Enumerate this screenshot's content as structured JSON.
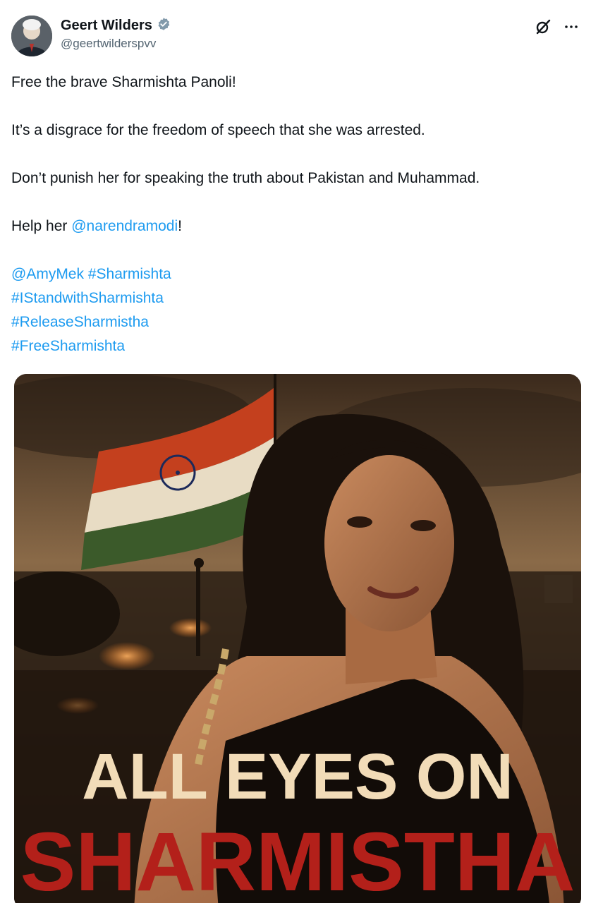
{
  "author": {
    "display_name": "Geert Wilders",
    "handle": "@geertwilderspvv",
    "verified": true
  },
  "tweet": {
    "line1": "Free the brave Sharmishta Panoli!",
    "line2": "It’s a disgrace for the freedom of speech that she was arrested.",
    "line3": "Don’t punish her for speaking the truth about Pakistan and Muhammad.",
    "help_prefix": "Help her ",
    "mention_modi": "@narendramodi",
    "help_suffix": "!",
    "mention_amy": "@AmyMek",
    "tag_sharmishta": "#Sharmishta",
    "tag_istand": "#IStandwithSharmishta",
    "tag_release": "#ReleaseSharmistha",
    "tag_free": "#FreeSharmishta"
  },
  "media": {
    "headline_line1": "ALL EYES ON",
    "headline_line2": "SHARMISTHA"
  },
  "icons": {
    "verified": "verified-badge-icon",
    "grok": "grok-icon",
    "more": "more-icon"
  },
  "colors": {
    "link": "#1d9bf0",
    "headline_top": "#f2dcb8",
    "headline_bottom": "#b3201a"
  }
}
